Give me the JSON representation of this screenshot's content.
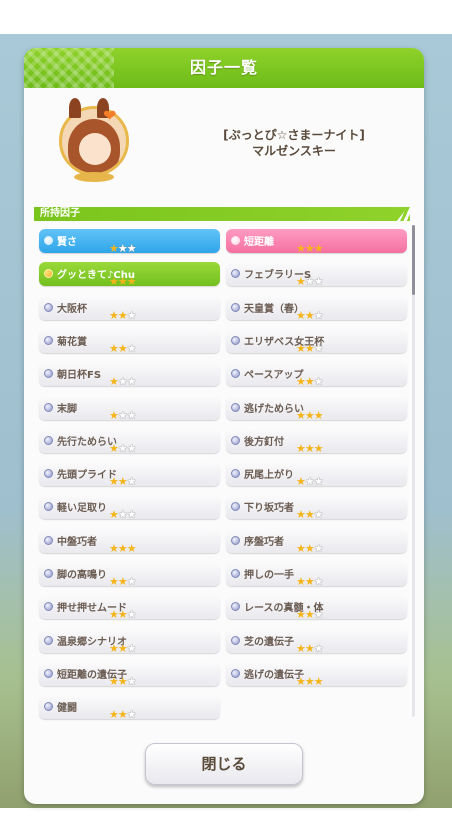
{
  "dialog": {
    "title": "因子一覧",
    "trainee_subtitle": "[ぷっとぴ☆さまーナイト]",
    "trainee_name": "マルゼンスキー",
    "section_label": "所持因子",
    "close_label": "閉じる"
  },
  "colors": {
    "header_green": "#7ac51c",
    "blue_factor": "#2fa5ea",
    "pink_factor": "#f4709f",
    "green_factor": "#72c01e",
    "star_gold": "#f4b51b"
  },
  "factors": [
    {
      "label": "賢さ",
      "stars": 1,
      "type": "blue"
    },
    {
      "label": "短距離",
      "stars": 3,
      "type": "pink"
    },
    {
      "label": "グッときて♪Chu",
      "stars": 3,
      "type": "green"
    },
    {
      "label": "フェブラリーS",
      "stars": 1,
      "type": "white"
    },
    {
      "label": "大阪杯",
      "stars": 2,
      "type": "white"
    },
    {
      "label": "天皇賞（春）",
      "stars": 2,
      "type": "white"
    },
    {
      "label": "菊花賞",
      "stars": 2,
      "type": "white"
    },
    {
      "label": "エリザベス女王杯",
      "stars": 2,
      "type": "white"
    },
    {
      "label": "朝日杯FS",
      "stars": 1,
      "type": "white"
    },
    {
      "label": "ペースアップ",
      "stars": 2,
      "type": "white"
    },
    {
      "label": "末脚",
      "stars": 1,
      "type": "white"
    },
    {
      "label": "逃げためらい",
      "stars": 3,
      "type": "white"
    },
    {
      "label": "先行ためらい",
      "stars": 1,
      "type": "white"
    },
    {
      "label": "後方釘付",
      "stars": 3,
      "type": "white"
    },
    {
      "label": "先頭プライド",
      "stars": 2,
      "type": "white"
    },
    {
      "label": "尻尾上がり",
      "stars": 1,
      "type": "white"
    },
    {
      "label": "軽い足取り",
      "stars": 1,
      "type": "white"
    },
    {
      "label": "下り坂巧者",
      "stars": 2,
      "type": "white"
    },
    {
      "label": "中盤巧者",
      "stars": 3,
      "type": "white"
    },
    {
      "label": "序盤巧者",
      "stars": 2,
      "type": "white"
    },
    {
      "label": "脚の高鳴り",
      "stars": 2,
      "type": "white"
    },
    {
      "label": "押しの一手",
      "stars": 2,
      "type": "white"
    },
    {
      "label": "押せ押せムード",
      "stars": 2,
      "type": "white"
    },
    {
      "label": "レースの真髄・体",
      "stars": 2,
      "type": "white"
    },
    {
      "label": "温泉郷シナリオ",
      "stars": 2,
      "type": "white"
    },
    {
      "label": "芝の遺伝子",
      "stars": 2,
      "type": "white"
    },
    {
      "label": "短距離の遺伝子",
      "stars": 2,
      "type": "white"
    },
    {
      "label": "逃げの遺伝子",
      "stars": 3,
      "type": "white"
    },
    {
      "label": "健闘",
      "stars": 2,
      "type": "white"
    }
  ]
}
